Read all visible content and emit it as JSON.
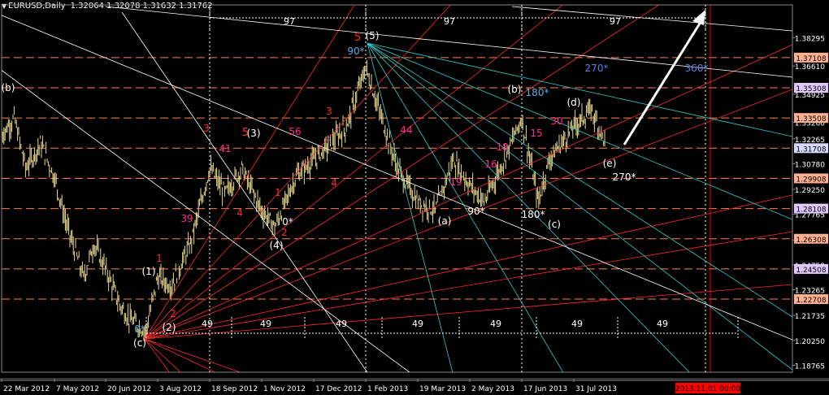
{
  "header": {
    "symbol": "EURUSD,Daily",
    "ohlc": "1.32064 1.32078 1.31632 1.31762"
  },
  "colors": {
    "background": "#000000",
    "bars": "#e6d98c",
    "red_line": "#ff2a2a",
    "cyan_line": "#33cccc",
    "white_line": "#ffffff",
    "level_line": "#ff7f50",
    "label_magenta": "#ff2a8c",
    "label_red": "#ff2a2a",
    "label_blue": "#5aaee0",
    "cyc_blue": "#5a7fe0",
    "dated_marker": "#ff0000"
  },
  "chart_data": {
    "type": "line",
    "title": "",
    "symbol": "EURUSD",
    "timeframe": "Daily",
    "ylim": [
      1.1835,
      1.4025
    ],
    "price_ticks": [
      "1.38295",
      "1.36610",
      "1.34925",
      "1.33260",
      "1.32265",
      "1.30780",
      "1.29250",
      "1.27765",
      "1.26230",
      "1.24750",
      "1.23265",
      "1.21735",
      "1.20250",
      "1.18765"
    ],
    "date_ticks": [
      "22 Mar 2012",
      "7 May 2012",
      "20 Jun 2012",
      "3 Aug 2012",
      "18 Sep 2012",
      "1 Nov 2012",
      "17 Dec 2012",
      "1 Feb 2013",
      "19 Mar 2013",
      "2 May 2013",
      "17 Jun 2013",
      "31 Jul 2013"
    ],
    "current_time_label": "2013.11.01 00:00",
    "horizontal_levels": [
      {
        "price": 1.37108,
        "label": "1.37108"
      },
      {
        "price": 1.35308,
        "label": "1.35308"
      },
      {
        "price": 1.33508,
        "label": "1.33508"
      },
      {
        "price": 1.31708,
        "label": "1.31708"
      },
      {
        "price": 1.29908,
        "label": "1.29908"
      },
      {
        "price": 1.28108,
        "label": "1.28108"
      },
      {
        "price": 1.26308,
        "label": "1.26308"
      },
      {
        "price": 1.24508,
        "label": "1.24508"
      },
      {
        "price": 1.22708,
        "label": "1.22708"
      }
    ],
    "price_series": [
      {
        "date": "22 Mar 2012",
        "close": 1.325
      },
      {
        "date": "2 Apr 2012",
        "close": 1.335
      },
      {
        "date": "12 Apr 2012",
        "close": 1.305
      },
      {
        "date": "25 Apr 2012",
        "close": 1.32
      },
      {
        "date": "7 May 2012",
        "close": 1.3
      },
      {
        "date": "18 May 2012",
        "close": 1.27
      },
      {
        "date": "1 Jun 2012",
        "close": 1.24
      },
      {
        "date": "10 Jun 2012",
        "close": 1.26
      },
      {
        "date": "20 Jun 2012",
        "close": 1.245
      },
      {
        "date": "1 Jul 2012",
        "close": 1.225
      },
      {
        "date": "10 Jul 2012",
        "close": 1.215
      },
      {
        "date": "24 Jul 2012",
        "close": 1.208
      },
      {
        "date": "3 Aug 2012",
        "close": 1.24
      },
      {
        "date": "15 Aug 2012",
        "close": 1.235
      },
      {
        "date": "1 Sep 2012",
        "close": 1.26
      },
      {
        "date": "18 Sep 2012",
        "close": 1.305
      },
      {
        "date": "1 Oct 2012",
        "close": 1.29
      },
      {
        "date": "15 Oct 2012",
        "close": 1.305
      },
      {
        "date": "1 Nov 2012",
        "close": 1.28
      },
      {
        "date": "13 Nov 2012",
        "close": 1.27
      },
      {
        "date": "1 Dec 2012",
        "close": 1.3
      },
      {
        "date": "17 Dec 2012",
        "close": 1.31
      },
      {
        "date": "1 Jan 2013",
        "close": 1.32
      },
      {
        "date": "15 Jan 2013",
        "close": 1.33
      },
      {
        "date": "1 Feb 2013",
        "close": 1.365
      },
      {
        "date": "15 Feb 2013",
        "close": 1.335
      },
      {
        "date": "1 Mar 2013",
        "close": 1.305
      },
      {
        "date": "19 Mar 2013",
        "close": 1.285
      },
      {
        "date": "3 Apr 2013",
        "close": 1.28
      },
      {
        "date": "18 Apr 2013",
        "close": 1.31
      },
      {
        "date": "2 May 2013",
        "close": 1.295
      },
      {
        "date": "15 May 2013",
        "close": 1.285
      },
      {
        "date": "1 Jun 2013",
        "close": 1.31
      },
      {
        "date": "17 Jun 2013",
        "close": 1.335
      },
      {
        "date": "1 Jul 2013",
        "close": 1.285
      },
      {
        "date": "10 Jul 2013",
        "close": 1.31
      },
      {
        "date": "31 Jul 2013",
        "close": 1.33
      },
      {
        "date": "15 Aug 2013",
        "close": 1.34
      },
      {
        "date": "27 Aug 2013",
        "close": 1.32
      }
    ],
    "annotations": [
      {
        "text": "(b)",
        "color": "white"
      },
      {
        "text": "(1)",
        "color": "white"
      },
      {
        "text": "(2)",
        "color": "white"
      },
      {
        "text": "(c)",
        "color": "white"
      },
      {
        "text": "(3)",
        "color": "white"
      },
      {
        "text": "(4)",
        "color": "white"
      },
      {
        "text": "(5)",
        "color": "white"
      },
      {
        "text": "5",
        "color": "red"
      },
      {
        "text": "(a)",
        "color": "white"
      },
      {
        "text": "(b)",
        "color": "white"
      },
      {
        "text": "(c)",
        "color": "white"
      },
      {
        "text": "(d)",
        "color": "white"
      },
      {
        "text": "(e)",
        "color": "white"
      },
      {
        "text": "1",
        "color": "red"
      },
      {
        "text": "2",
        "color": "red"
      },
      {
        "text": "3",
        "color": "red"
      },
      {
        "text": "4",
        "color": "red"
      },
      {
        "text": "5",
        "color": "red"
      },
      {
        "text": "1",
        "color": "red"
      },
      {
        "text": "2",
        "color": "red"
      },
      {
        "text": "3",
        "color": "red"
      },
      {
        "text": "4",
        "color": "red"
      },
      {
        "text": "39",
        "color": "magenta"
      },
      {
        "text": "41",
        "color": "magenta"
      },
      {
        "text": "56",
        "color": "magenta"
      },
      {
        "text": "44",
        "color": "magenta"
      },
      {
        "text": "19",
        "color": "magenta"
      },
      {
        "text": "16",
        "color": "magenta"
      },
      {
        "text": "18",
        "color": "magenta"
      },
      {
        "text": "15",
        "color": "magenta"
      },
      {
        "text": "30",
        "color": "magenta"
      },
      {
        "text": "0*",
        "color": "blue"
      },
      {
        "text": "0*",
        "color": "white"
      },
      {
        "text": "90*",
        "color": "blue"
      },
      {
        "text": "90*",
        "color": "white"
      },
      {
        "text": "180*",
        "color": "blue"
      },
      {
        "text": "180*",
        "color": "white"
      },
      {
        "text": "270*",
        "color": "cycblue"
      },
      {
        "text": "270*",
        "color": "white"
      },
      {
        "text": "360*",
        "color": "cycblue"
      }
    ],
    "cycle_labels_top": [
      "97",
      "97",
      "97"
    ],
    "cycle_labels_bottom": [
      "49",
      "49",
      "49",
      "49",
      "49",
      "49",
      "49"
    ]
  }
}
